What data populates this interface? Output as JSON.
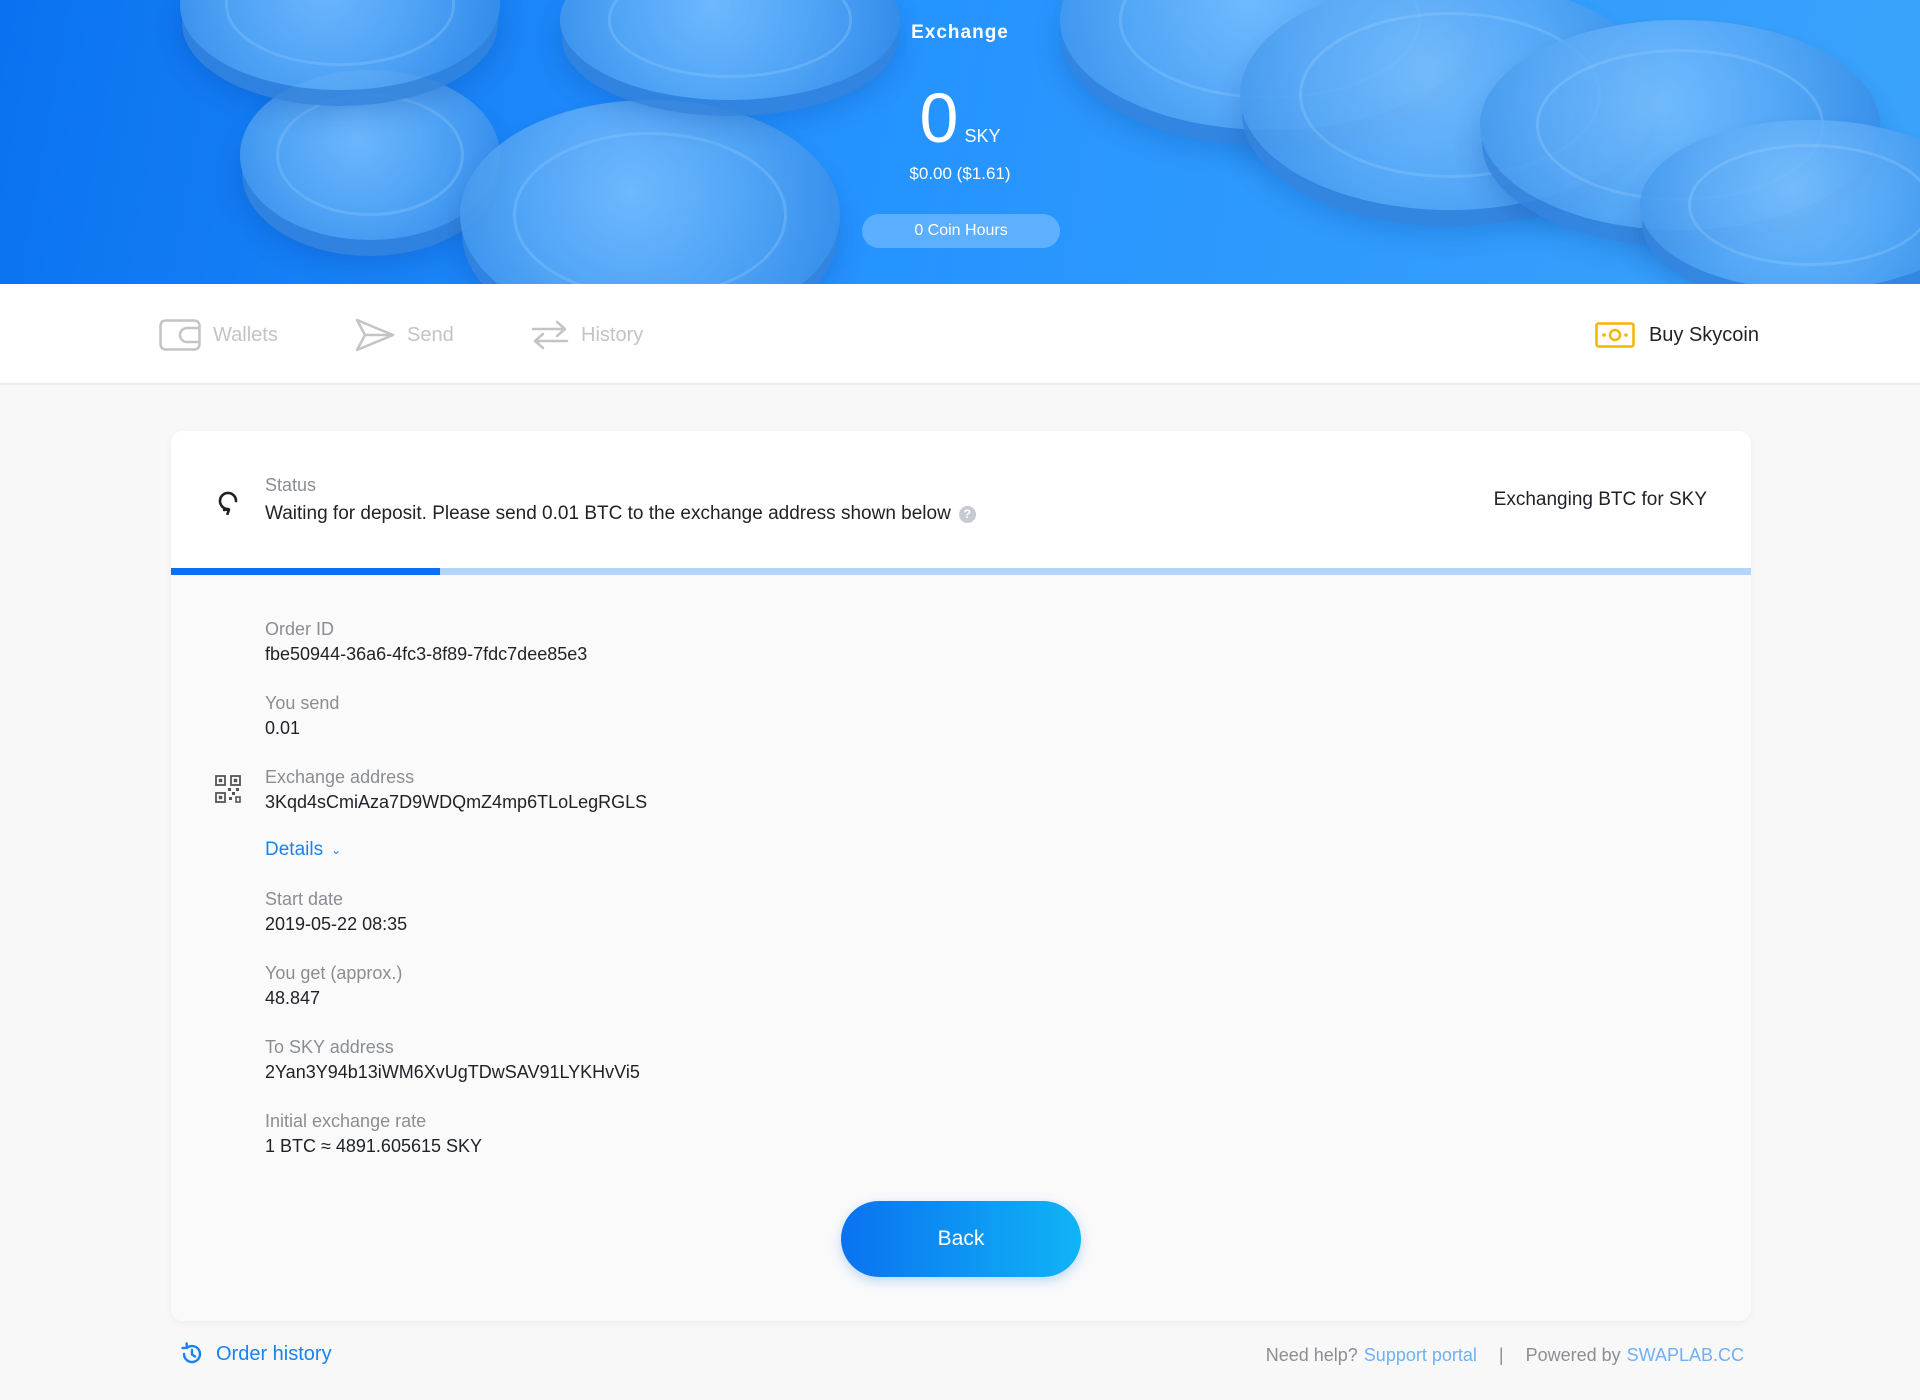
{
  "header": {
    "title": "Exchange",
    "balance": "0",
    "balance_unit": "SKY",
    "usd": "$0.00 ($1.61)",
    "coin_hours": "0 Coin Hours"
  },
  "nav": {
    "items": [
      {
        "label": "Wallets",
        "icon": "wallet-icon"
      },
      {
        "label": "Send",
        "icon": "send-icon"
      },
      {
        "label": "History",
        "icon": "transfer-arrows-icon"
      }
    ],
    "buy_label": "Buy Skycoin",
    "buy_icon": "banknote-icon",
    "buy_icon_color": "#f5b400"
  },
  "status": {
    "label": "Status",
    "text": "Waiting for deposit. Please send 0.01 BTC to the exchange address shown below",
    "help_icon": "?",
    "exchanging": "Exchanging BTC for SKY",
    "progress": 0.17
  },
  "fields": {
    "order_id": {
      "label": "Order ID",
      "value": "fbe50944-36a6-4fc3-8f89-7fdc7dee85e3"
    },
    "you_send": {
      "label": "You send",
      "value": "0.01"
    },
    "exchange_address": {
      "label": "Exchange address",
      "value": "3Kqd4sCmiAza7D9WDQmZ4mp6TLoLegRGLS"
    },
    "details": "Details",
    "start_date": {
      "label": "Start date",
      "value": "2019-05-22 08:35"
    },
    "you_get": {
      "label": "You get (approx.)",
      "value": "48.847"
    },
    "to_address": {
      "label": "To SKY address",
      "value": "2Yan3Y94b13iWM6XvUgTDwSAV91LYKHvVi5"
    },
    "rate": {
      "label": "Initial exchange rate",
      "value": "1 BTC ≈ 4891.605615 SKY"
    }
  },
  "back_label": "Back",
  "footer": {
    "order_history": "Order history",
    "need_help": "Need help?",
    "support_link": "Support portal",
    "separator": "|",
    "powered_by": "Powered by",
    "swaplab_link": "SWAPLAB.CC"
  },
  "colors": {
    "accent": "#0a72f0",
    "link": "#1a82ec",
    "progress_track": "#b2d5fb"
  }
}
